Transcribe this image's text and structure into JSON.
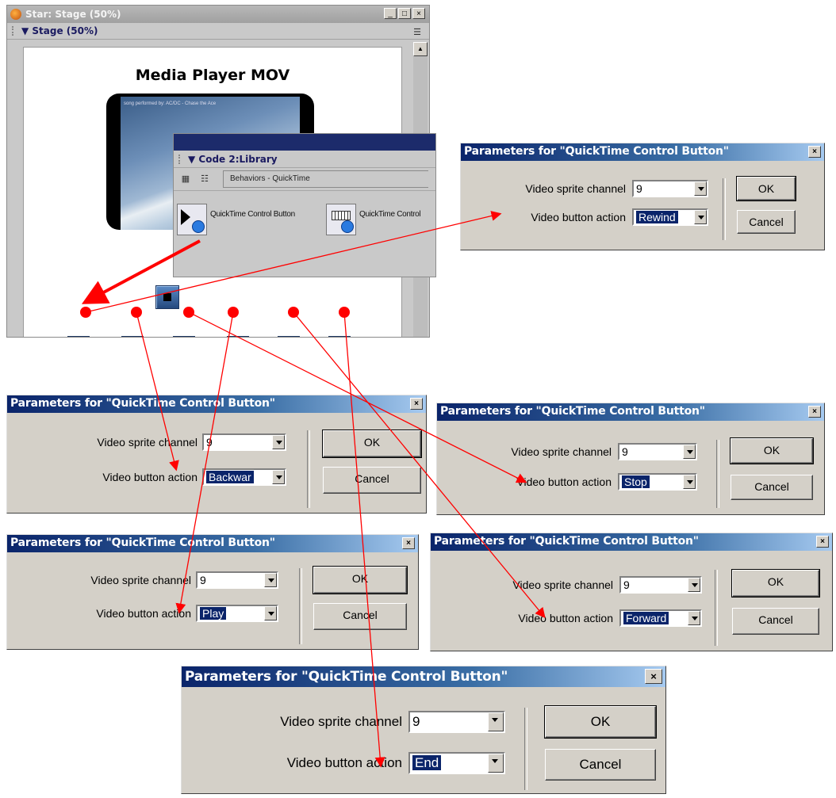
{
  "stage_window": {
    "title": "Star: Stage (50%)",
    "panel_label": "Stage (50%)",
    "minimize": "_",
    "maximize": "□",
    "close": "×"
  },
  "stage_canvas": {
    "heading": "Media Player MOV",
    "video_caption": "song performed by: AC/DC - Chase the Ace"
  },
  "library_panel": {
    "panel_label": "Code 2:Library",
    "dropdown_value": "Behaviors - QuickTime",
    "items": [
      {
        "label": "QuickTime Control Button"
      },
      {
        "label": "QuickTime Control"
      }
    ]
  },
  "dialog_common": {
    "title": "Parameters for \"QuickTime Control Button\"",
    "channel_label": "Video sprite channel",
    "action_label": "Video button action",
    "ok_label": "OK",
    "cancel_label": "Cancel",
    "close_label": "×"
  },
  "dialogs": [
    {
      "channel": "9",
      "action": "Rewind"
    },
    {
      "channel": "9",
      "action": "Backwar"
    },
    {
      "channel": "9",
      "action": "Stop"
    },
    {
      "channel": "9",
      "action": "Play"
    },
    {
      "channel": "9",
      "action": "Forward"
    },
    {
      "channel": "9",
      "action": "End"
    }
  ],
  "colors": {
    "annotation_arrow": "#ff0000",
    "dialog_title_start": "#0a246a",
    "dialog_title_end": "#a6caf0"
  }
}
